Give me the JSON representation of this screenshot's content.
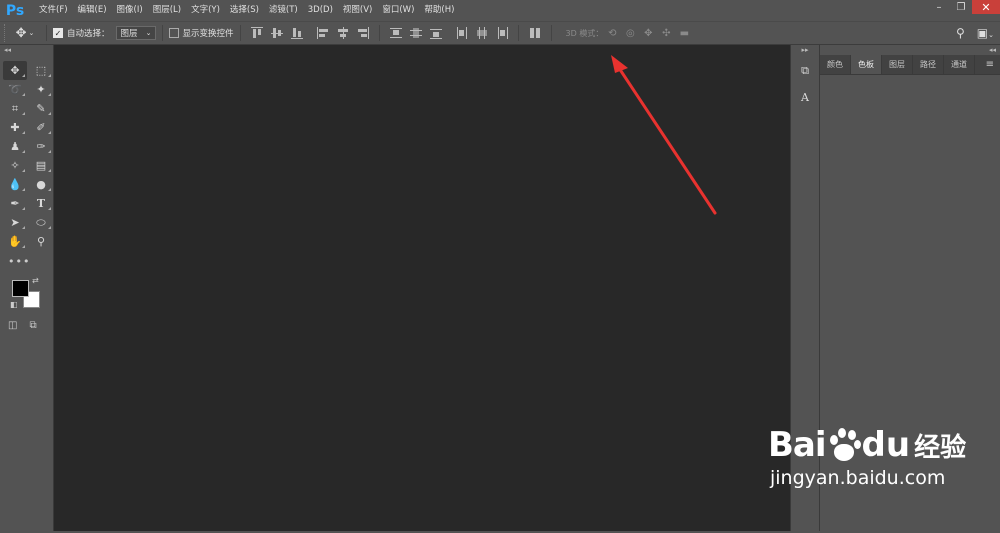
{
  "app": {
    "logo": "Ps"
  },
  "menu": [
    "文件(F)",
    "编辑(E)",
    "图像(I)",
    "图层(L)",
    "文字(Y)",
    "选择(S)",
    "滤镜(T)",
    "3D(D)",
    "视图(V)",
    "窗口(W)",
    "帮助(H)"
  ],
  "window": {
    "minimize": "–",
    "restore": "❐",
    "close": "✕"
  },
  "options": {
    "tool_icon": "move-icon",
    "auto_select_label": "自动选择：",
    "auto_select_checked": true,
    "auto_select_value": "图层",
    "show_transform_label": "显示变换控件",
    "show_transform_checked": false,
    "mode3d_label": "3D 模式："
  },
  "right_panel": {
    "tabs": [
      "颜色",
      "色板",
      "图层",
      "路径",
      "通道"
    ],
    "active_tab": "色板"
  },
  "watermark": {
    "brand_a": "Bai",
    "brand_b": "du",
    "brand_cn": "经验",
    "url": "jingyan.baidu.com"
  },
  "colors": {
    "foreground": "#000000",
    "background": "#ffffff",
    "arrow": "#e8322f",
    "canvas": "#282828",
    "chrome": "#535353"
  }
}
